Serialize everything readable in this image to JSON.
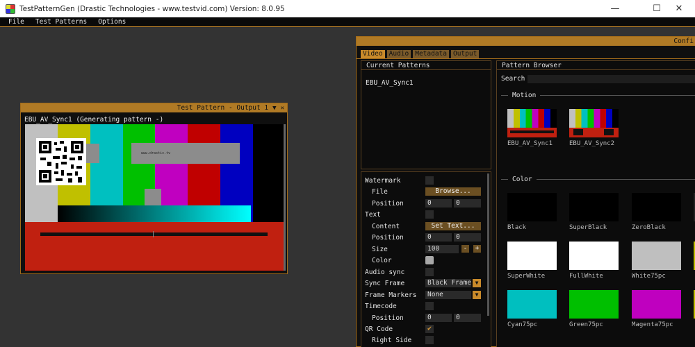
{
  "window": {
    "title": "TestPatternGen (Drastic Technologies - www.testvid.com)  Version: 8.0.95",
    "minimize": "—",
    "maximize": "☐",
    "close": "✕"
  },
  "menu": [
    "File",
    "Test Patterns",
    "Options"
  ],
  "test_window": {
    "title": "Test Pattern - Output 1",
    "collapse_icon": "▼",
    "close_icon": "✕",
    "status": "EBU_AV_Sync1  (Generating pattern -)",
    "url_text": "www.drastic.tv"
  },
  "config": {
    "title": "Confi",
    "tabs": [
      "Video",
      "Audio",
      "Metadata",
      "Output"
    ],
    "current_patterns": {
      "header": "Current Patterns",
      "items": [
        "EBU_AV_Sync1"
      ]
    },
    "settings": {
      "watermark": "Watermark",
      "file": "File",
      "browse": "Browse...",
      "position": "Position",
      "text": "Text",
      "content": "Content",
      "set_text": "Set Text...",
      "text_position": "Position",
      "size": "Size",
      "size_value": "100",
      "minus": "-",
      "plus": "+",
      "color": "Color",
      "audio_sync": "Audio sync",
      "sync_frame": "Sync Frame",
      "sync_frame_value": "Black Frame",
      "frame_markers": "Frame Markers",
      "frame_markers_value": "None",
      "timecode": "Timecode",
      "tc_position": "Position",
      "qr_code": "QR Code",
      "right_side": "Right Side",
      "zero": "0",
      "checkmark": "✔",
      "dd_arrow": "▼"
    },
    "browser": {
      "header": "Pattern Browser",
      "search_label": "Search",
      "motion_section": "Motion",
      "color_section": "Color",
      "motion_items": [
        "EBU_AV_Sync1",
        "EBU_AV_Sync2"
      ],
      "color_items": [
        {
          "name": "Black",
          "color": "#000000"
        },
        {
          "name": "SuperBlack",
          "color": "#000000"
        },
        {
          "name": "ZeroBlack",
          "color": "#000000"
        },
        {
          "name": "SuperWhite",
          "color": "#ffffff"
        },
        {
          "name": "FullWhite",
          "color": "#ffffff"
        },
        {
          "name": "White75pc",
          "color": "#bfbfbf"
        },
        {
          "name": "Cyan75pc",
          "color": "#00bfbf"
        },
        {
          "name": "Green75pc",
          "color": "#00bf00"
        },
        {
          "name": "Magenta75pc",
          "color": "#bf00bf"
        }
      ]
    }
  },
  "colors": {
    "accent": "#c98a2a",
    "panel_border": "#5a4020",
    "background": "#333333"
  },
  "pattern_bars": [
    "#c0c0c0",
    "#c0c000",
    "#00c0c0",
    "#00c000",
    "#c000c0",
    "#c00000",
    "#0000c0",
    "#000000"
  ]
}
